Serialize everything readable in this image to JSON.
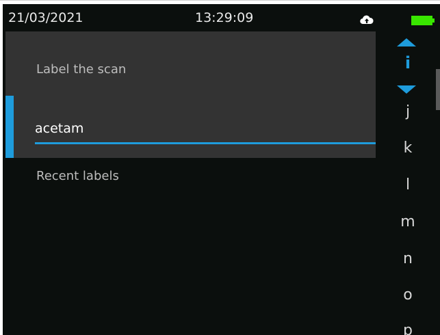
{
  "status": {
    "date": "21/03/2021",
    "time": "13:29:09",
    "cloud_icon": "cloud-upload-icon",
    "battery_icon": "battery-full-icon",
    "battery_color": "#39e600"
  },
  "dialog": {
    "title": "Label the scan",
    "input_value": "acetam",
    "accent_color": "#1e9cdc"
  },
  "recent": {
    "heading": "Recent labels"
  },
  "picker": {
    "selected": "i",
    "letters": [
      "j",
      "k",
      "l",
      "m",
      "n",
      "o",
      "p"
    ],
    "up_icon": "triangle-up-icon",
    "down_icon": "triangle-down-icon"
  }
}
